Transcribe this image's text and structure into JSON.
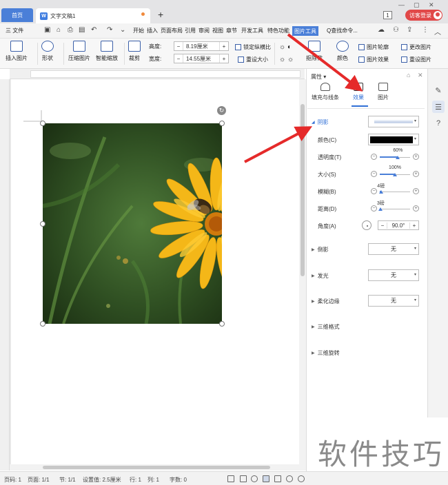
{
  "titlebar": {
    "home_tab": "首页",
    "doc_tab": "文字文稿1",
    "doc_tab_icon": "W",
    "new_tab": "+",
    "window_count": "1",
    "login_label": "访客登录"
  },
  "menubar": {
    "file_label": "三 文件",
    "items": [
      "开始",
      "插入",
      "页面布局",
      "引用",
      "审阅",
      "视图",
      "章节",
      "开发工具",
      "特色功能"
    ],
    "active_tab": "图片工具",
    "search_label": "Q查找命令..."
  },
  "ribbon": {
    "insert_picture": "插入图片",
    "shape": "形状",
    "compress": "压缩图片",
    "smart_zoom": "智能缩放",
    "crop": "裁剪",
    "height_label": "高度:",
    "height_value": "8.19厘米",
    "width_label": "宽度:",
    "width_value": "14.55厘米",
    "lock_ratio": "锁定纵横比",
    "reset_size": "重设大小",
    "color": "颜色",
    "picture_outline": "图片轮廓",
    "picture_effect": "图片效果",
    "change_picture": "更改图片",
    "reset_picture": "重设图片",
    "matting": "抠除背"
  },
  "panel": {
    "title": "属性",
    "tabs": [
      "填充与线条",
      "效果",
      "图片"
    ],
    "active_tab": "效果",
    "shadow": {
      "label": "阴影",
      "color_label": "颜色(C)",
      "color_value": "#000000",
      "transparency_label": "透明度(T)",
      "transparency_value": "60%",
      "transparency_fraction": 0.6,
      "size_label": "大小(S)",
      "size_value": "100%",
      "size_fraction": 0.5,
      "blur_label": "模糊(B)",
      "blur_value": "4磅",
      "blur_fraction": 0.04,
      "distance_label": "距离(D)",
      "distance_value": "3磅",
      "distance_fraction": 0.03,
      "angle_label": "角度(A)",
      "angle_value": "90.0°"
    },
    "sections": [
      {
        "label": "倒影",
        "value": "无"
      },
      {
        "label": "发光",
        "value": "无"
      },
      {
        "label": "柔化边缘",
        "value": "无"
      },
      {
        "label": "三维格式",
        "value": ""
      },
      {
        "label": "三维旋转",
        "value": ""
      }
    ]
  },
  "statusbar": {
    "page_code": "页码: 1",
    "page": "页面: 1/1",
    "section": "节: 1/1",
    "settings": "设置值: 2.5厘米",
    "line": "行: 1",
    "column": "列: 1",
    "word_count": "字数: 0"
  },
  "watermark": "软件技巧",
  "colors": {
    "accent": "#4a7fd8",
    "login": "#e14848",
    "arrow": "#e52a2a"
  }
}
